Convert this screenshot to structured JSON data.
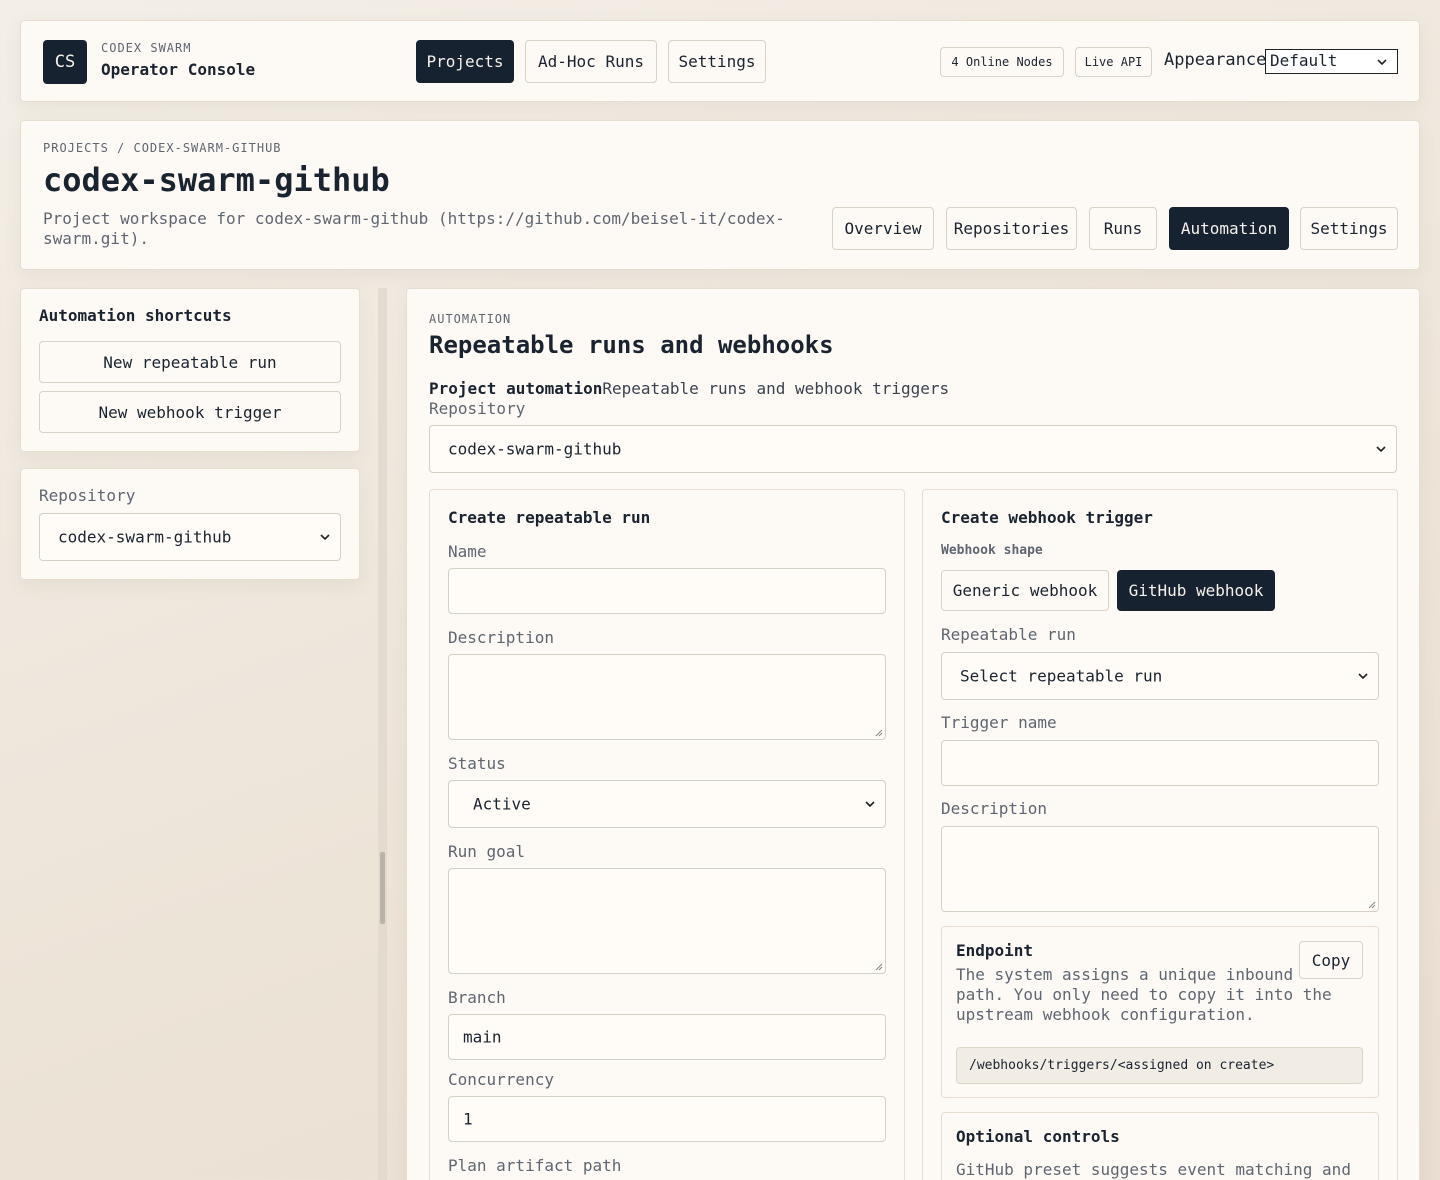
{
  "header": {
    "logo_initials": "CS",
    "brand_eyebrow": "CODEX SWARM",
    "brand_title": "Operator Console",
    "nav": {
      "projects": "Projects",
      "adhoc": "Ad-Hoc Runs",
      "settings": "Settings"
    },
    "online_nodes": "4 Online Nodes",
    "live_api": "Live API",
    "appearance_label": "Appearance",
    "appearance_value": "Default"
  },
  "project": {
    "breadcrumb": "PROJECTS / CODEX-SWARM-GITHUB",
    "title": "codex-swarm-github",
    "description_line1": "Project workspace for codex-swarm-github (https://github.com/beisel-it/codex-",
    "description_line2": "swarm.git).",
    "tabs": {
      "overview": "Overview",
      "repositories": "Repositories",
      "runs": "Runs",
      "automation": "Automation",
      "settings": "Settings"
    }
  },
  "sidebar": {
    "shortcuts_title": "Automation shortcuts",
    "new_repeatable_run": "New repeatable run",
    "new_webhook_trigger": "New webhook trigger",
    "repository_label": "Repository",
    "repository_value": "codex-swarm-github"
  },
  "main": {
    "eyebrow": "AUTOMATION",
    "title": "Repeatable runs and webhooks",
    "summary_bold": "Project automation",
    "summary_text": "Repeatable runs and webhook triggers",
    "repository_label": "Repository",
    "repository_value": "codex-swarm-github",
    "repeatable": {
      "title": "Create repeatable run",
      "name_label": "Name",
      "name_value": "",
      "description_label": "Description",
      "description_value": "",
      "status_label": "Status",
      "status_value": "Active",
      "goal_label": "Run goal",
      "goal_value": "",
      "branch_label": "Branch",
      "branch_value": "main",
      "concurrency_label": "Concurrency",
      "concurrency_value": "1",
      "plan_label": "Plan artifact path"
    },
    "webhook": {
      "title": "Create webhook trigger",
      "shape_label": "Webhook shape",
      "generic": "Generic webhook",
      "github": "GitHub webhook",
      "run_label": "Repeatable run",
      "run_value": "Select repeatable run",
      "trigger_name_label": "Trigger name",
      "trigger_name_value": "",
      "description_label": "Description",
      "description_value": "",
      "endpoint_title": "Endpoint",
      "endpoint_line1": "The system assigns a unique inbound",
      "endpoint_line2": "path. You only need to copy it into the",
      "endpoint_line3": "upstream webhook configuration.",
      "copy": "Copy",
      "endpoint_path": "/webhooks/triggers/<assigned on create>",
      "optional_title": "Optional controls",
      "optional_text": "GitHub preset suggests event matching and"
    }
  },
  "colors": {
    "accent_dark": "#172230",
    "surface": "#fdfaf5",
    "muted_text": "#5f6672"
  }
}
